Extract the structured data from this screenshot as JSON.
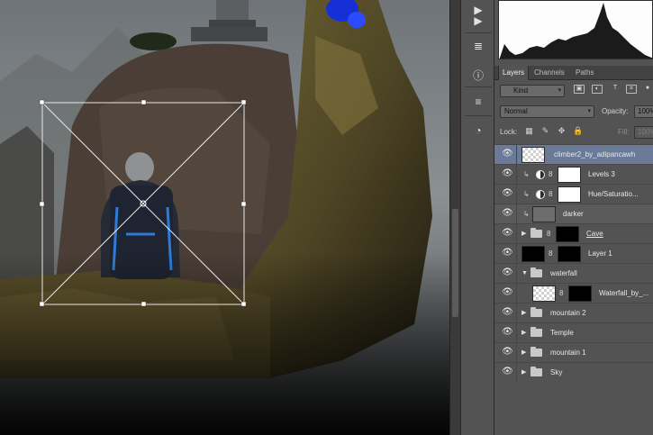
{
  "panel": {
    "tabs": [
      "Layers",
      "Channels",
      "Paths"
    ],
    "active_tab": "Layers",
    "filter": {
      "kind_label": "Kind"
    },
    "blend": {
      "mode": "Normal",
      "opacity_label": "Opacity:",
      "opacity_value": "100%"
    },
    "lock": {
      "label": "Lock:",
      "fill_label": "Fill:",
      "fill_value": "100%"
    }
  },
  "layers": [
    {
      "name": "climber2_by_adipancawh",
      "type": "smart",
      "selected": true
    },
    {
      "name": "Levels 3",
      "type": "adjustment",
      "clipped": true
    },
    {
      "name": "Hue/Saturatio...",
      "type": "adjustment",
      "clipped": true
    },
    {
      "name": "darker",
      "type": "pixel",
      "clipped": true
    },
    {
      "name": "Cave",
      "type": "group",
      "expanded": false
    },
    {
      "name": "Layer 1",
      "type": "pixel-masked"
    },
    {
      "name": "waterfall",
      "type": "group",
      "expanded": true
    },
    {
      "name": "Waterfall_by_...",
      "type": "smart-masked"
    },
    {
      "name": "mountain 2",
      "type": "group",
      "expanded": false
    },
    {
      "name": "Temple",
      "type": "group",
      "expanded": false
    },
    {
      "name": "mountain 1",
      "type": "group",
      "expanded": false
    },
    {
      "name": "Sky",
      "type": "group",
      "expanded": false
    }
  ],
  "icons": {
    "eye": "👁",
    "twirl_closed": "▶",
    "twirl_open": "▼",
    "clip": "↳",
    "link": "8",
    "dock": [
      "▶",
      "▶",
      "≣",
      "ⓘ",
      "≡",
      "◔"
    ],
    "filters": [
      "▣",
      "◐",
      "T",
      "⌗",
      "●"
    ],
    "locks": [
      "▦",
      "✎",
      "✥",
      "🔒"
    ]
  }
}
